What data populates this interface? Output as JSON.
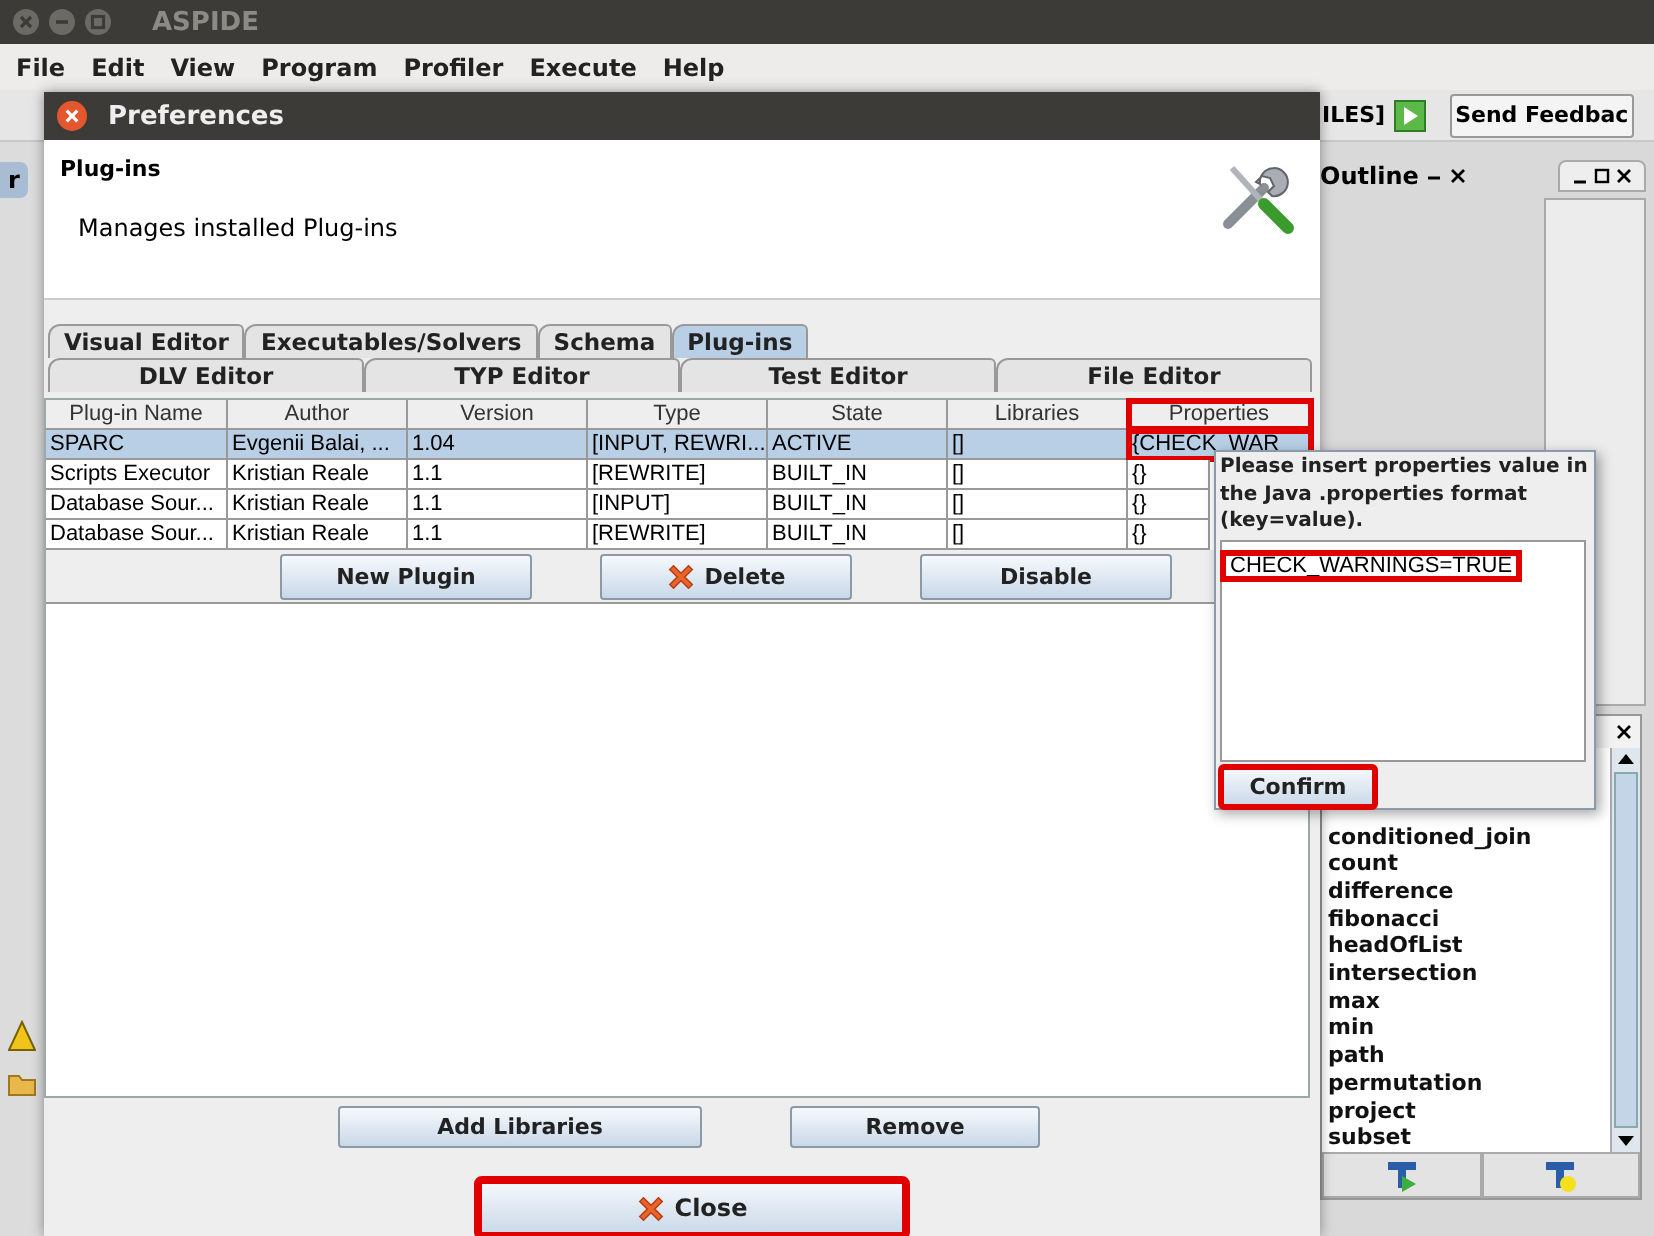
{
  "app": {
    "title": "ASPIDE",
    "menu": [
      "File",
      "Edit",
      "View",
      "Program",
      "Profiler",
      "Execute",
      "Help"
    ],
    "toolbar_text": "ILES]",
    "feedback_button": "Send Feedbac",
    "left_tab": "r",
    "outline_tab": "Outline",
    "functions": [
      "conditioned_join",
      "count",
      "difference",
      "fibonacci",
      "headOfList",
      "intersection",
      "max",
      "min",
      "path",
      "permutation",
      "project",
      "subset"
    ]
  },
  "dialog": {
    "title": "Preferences",
    "heading": "Plug-ins",
    "description": "Manages installed Plug-ins",
    "tab_rows": [
      [
        {
          "label": "Visual Editor",
          "selected": false
        },
        {
          "label": "Executables/Solvers",
          "selected": false
        },
        {
          "label": "Schema",
          "selected": false
        },
        {
          "label": "Plug-ins",
          "selected": true
        }
      ],
      [
        {
          "label": "DLV Editor",
          "selected": false
        },
        {
          "label": "TYP Editor",
          "selected": false
        },
        {
          "label": "Test Editor",
          "selected": false
        },
        {
          "label": "File Editor",
          "selected": false
        }
      ]
    ],
    "table": {
      "columns": [
        {
          "label": "Plug-in Name",
          "highlighted": false
        },
        {
          "label": "Author",
          "highlighted": false
        },
        {
          "label": "Version",
          "highlighted": false
        },
        {
          "label": "Type",
          "highlighted": false
        },
        {
          "label": "State",
          "highlighted": false
        },
        {
          "label": "Libraries",
          "highlighted": false
        },
        {
          "label": "Properties",
          "highlighted": true
        }
      ],
      "rows": [
        {
          "selected": true,
          "cells": [
            {
              "text": "SPARC",
              "highlighted": false
            },
            {
              "text": "Evgenii Balai, ...",
              "highlighted": false
            },
            {
              "text": "1.04",
              "highlighted": false
            },
            {
              "text": "[INPUT, REWRI...",
              "highlighted": false
            },
            {
              "text": "ACTIVE",
              "highlighted": false
            },
            {
              "text": "[]",
              "highlighted": false
            },
            {
              "text": "{CHECK_WAR",
              "highlighted": true
            }
          ]
        },
        {
          "selected": false,
          "cells": [
            {
              "text": "Scripts Executor",
              "highlighted": false
            },
            {
              "text": "Kristian Reale",
              "highlighted": false
            },
            {
              "text": "1.1",
              "highlighted": false
            },
            {
              "text": "[REWRITE]",
              "highlighted": false
            },
            {
              "text": "BUILT_IN",
              "highlighted": false
            },
            {
              "text": "[]",
              "highlighted": false
            },
            {
              "text": "{}",
              "highlighted": false
            }
          ]
        },
        {
          "selected": false,
          "cells": [
            {
              "text": "Database Sour...",
              "highlighted": false
            },
            {
              "text": "Kristian Reale",
              "highlighted": false
            },
            {
              "text": "1.1",
              "highlighted": false
            },
            {
              "text": "[INPUT]",
              "highlighted": false
            },
            {
              "text": "BUILT_IN",
              "highlighted": false
            },
            {
              "text": "[]",
              "highlighted": false
            },
            {
              "text": "{}",
              "highlighted": false
            }
          ]
        },
        {
          "selected": false,
          "cells": [
            {
              "text": "Database Sour...",
              "highlighted": false
            },
            {
              "text": "Kristian Reale",
              "highlighted": false
            },
            {
              "text": "1.1",
              "highlighted": false
            },
            {
              "text": "[REWRITE]",
              "highlighted": false
            },
            {
              "text": "BUILT_IN",
              "highlighted": false
            },
            {
              "text": "[]",
              "highlighted": false
            },
            {
              "text": "{}",
              "highlighted": false
            }
          ]
        }
      ]
    },
    "plugin_buttons": [
      {
        "label": "New Plugin"
      },
      {
        "label": "Delete"
      },
      {
        "label": "Disable"
      }
    ],
    "library_buttons": [
      {
        "label": "Add Libraries"
      },
      {
        "label": "Remove"
      }
    ],
    "close_button": {
      "label": "Close",
      "highlighted": true
    }
  },
  "popup": {
    "message": "Please insert properties value in the Java .properties format (key=value).",
    "value": "CHECK_WARNINGS=TRUE",
    "value_highlighted": true,
    "confirm": {
      "label": "Confirm",
      "highlighted": true
    }
  }
}
